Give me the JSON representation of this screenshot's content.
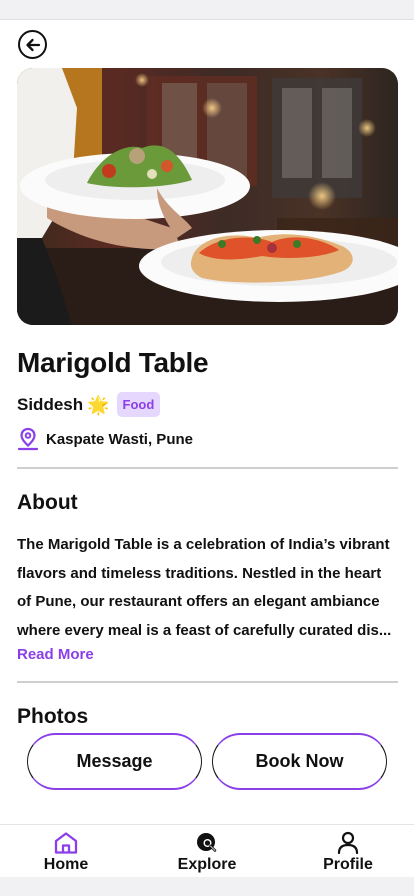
{
  "header": {
    "back_icon": "arrow-left-circle-icon"
  },
  "hero": {
    "image_subject": "restaurant food plates"
  },
  "listing": {
    "title": "Marigold Table",
    "host": "Siddesh",
    "host_badge_icon": "sparkle-icon",
    "category_tag": "Food",
    "location_icon": "location-pin-icon",
    "location": "Kaspate Wasti, Pune"
  },
  "about": {
    "title": "About",
    "line1": "The Marigold Table is a celebration of India’s vibrant",
    "line2": "flavors and timeless traditions. Nestled in the heart",
    "line3": "of Pune, our restaurant offers an elegant ambiance",
    "line4": "where every meal is a feast of carefully curated dis...",
    "read_more": "Read More"
  },
  "photos": {
    "title": "Photos"
  },
  "actions": {
    "message": "Message",
    "book": "Book Now"
  },
  "nav": {
    "items": [
      {
        "label": "Home",
        "icon": "home-icon"
      },
      {
        "label": "Explore",
        "icon": "explore-search-icon"
      },
      {
        "label": "Profile",
        "icon": "user-icon"
      }
    ]
  },
  "colors": {
    "accent": "#8a3fe8",
    "tag_bg": "#e6d7ff",
    "text": "#111111"
  }
}
